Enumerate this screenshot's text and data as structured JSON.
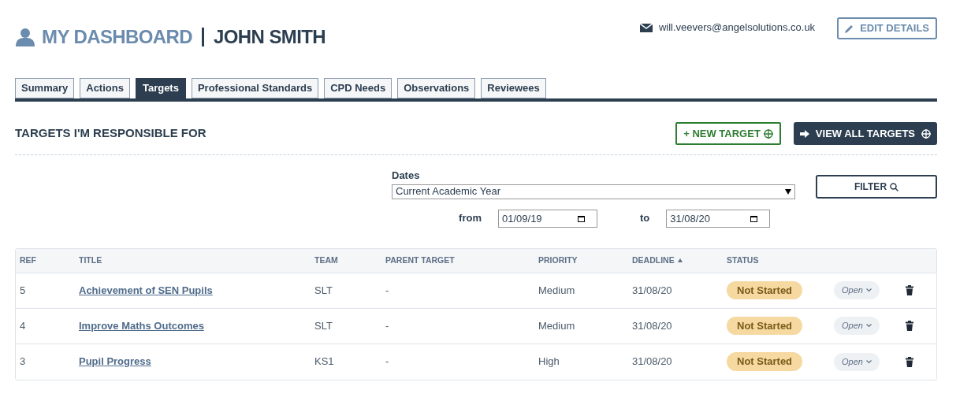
{
  "header": {
    "title": "MY DASHBOARD",
    "name": "JOHN SMITH",
    "email": "will.veevers@angelsolutions.co.uk",
    "edit_button": "EDIT DETAILS"
  },
  "tabs": [
    {
      "label": "Summary",
      "selected": false
    },
    {
      "label": "Actions",
      "selected": false
    },
    {
      "label": "Targets",
      "selected": true
    },
    {
      "label": "Professional Standards",
      "selected": false
    },
    {
      "label": "CPD Needs",
      "selected": false
    },
    {
      "label": "Observations",
      "selected": false
    },
    {
      "label": "Reviewees",
      "selected": false
    }
  ],
  "section": {
    "title": "TARGETS I'M RESPONSIBLE FOR",
    "new_button": "+ NEW TARGET",
    "view_all_button": "VIEW ALL TARGETS"
  },
  "filter": {
    "dates_label": "Dates",
    "dates_value": "Current Academic Year",
    "from_label": "from",
    "from_value": "01/09/19",
    "to_label": "to",
    "to_value": "31/08/20",
    "button": "FILTER"
  },
  "table": {
    "columns": [
      {
        "label": "REF",
        "sorted": false
      },
      {
        "label": "TITLE",
        "sorted": false
      },
      {
        "label": "TEAM",
        "sorted": false
      },
      {
        "label": "PARENT TARGET",
        "sorted": false
      },
      {
        "label": "PRIORITY",
        "sorted": false
      },
      {
        "label": "DEADLINE",
        "sorted": true
      },
      {
        "label": "STATUS",
        "sorted": false
      }
    ],
    "rows": [
      {
        "ref": "5",
        "title": "Achievement of SEN Pupils",
        "team": "SLT",
        "parent": "-",
        "priority": "Medium",
        "deadline": "31/08/20",
        "status": "Not Started",
        "action": "Open"
      },
      {
        "ref": "4",
        "title": "Improve Maths Outcomes",
        "team": "SLT",
        "parent": "-",
        "priority": "Medium",
        "deadline": "31/08/20",
        "status": "Not Started",
        "action": "Open"
      },
      {
        "ref": "3",
        "title": "Pupil Progress",
        "team": "KS1",
        "parent": "-",
        "priority": "High",
        "deadline": "31/08/20",
        "status": "Not Started",
        "action": "Open"
      }
    ]
  }
}
